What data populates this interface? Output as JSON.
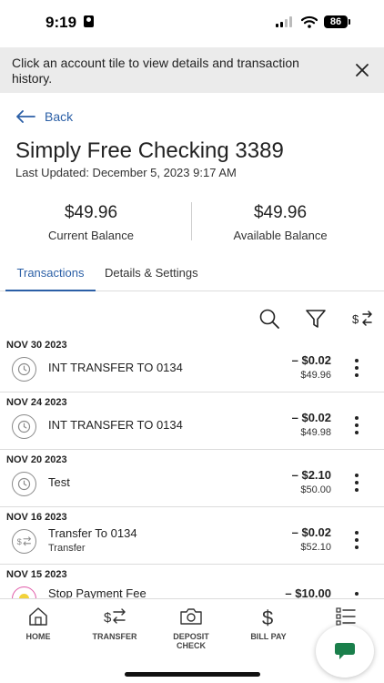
{
  "status": {
    "time": "9:19",
    "battery": "86"
  },
  "banner": {
    "text": "Click an account tile to view details and transaction history."
  },
  "nav": {
    "back_label": "Back"
  },
  "account": {
    "title": "Simply Free Checking 3389",
    "updated": "Last Updated: December 5, 2023 9:17 AM",
    "current_balance": "$49.96",
    "current_label": "Current Balance",
    "available_balance": "$49.96",
    "available_label": "Available Balance"
  },
  "tabs": [
    {
      "label": "Transactions"
    },
    {
      "label": "Details & Settings"
    }
  ],
  "icons": {
    "search": "search-icon",
    "filter": "filter-icon",
    "sort": "transfer-sort-icon"
  },
  "transactions": [
    {
      "date": "NOV 30 2023",
      "description": "INT TRANSFER TO 0134",
      "sub": "",
      "amount": "– $0.02",
      "balance": "$49.96",
      "icon": "pending-clock-icon"
    },
    {
      "date": "NOV 24 2023",
      "description": "INT TRANSFER TO 0134",
      "sub": "",
      "amount": "– $0.02",
      "balance": "$49.98",
      "icon": "pending-clock-icon"
    },
    {
      "date": "NOV 20 2023",
      "description": "Test",
      "sub": "",
      "amount": "– $2.10",
      "balance": "$50.00",
      "icon": "pending-clock-icon"
    },
    {
      "date": "NOV 16 2023",
      "description": "Transfer To 0134",
      "sub": "Transfer",
      "amount": "– $0.02",
      "balance": "$52.10",
      "icon": "transfer-icon"
    },
    {
      "date": "NOV 15 2023",
      "description": "Stop Payment Fee",
      "sub": "",
      "amount": "– $10.00",
      "balance": "",
      "icon": "fee-icon"
    }
  ],
  "bottom_nav": [
    {
      "label": "HOME"
    },
    {
      "label": "TRANSFER"
    },
    {
      "label": "DEPOSIT CHECK"
    },
    {
      "label": "BILL PAY"
    },
    {
      "label": ""
    }
  ],
  "colors": {
    "accent": "#2b5fa6",
    "chat": "#1a7f4b"
  }
}
